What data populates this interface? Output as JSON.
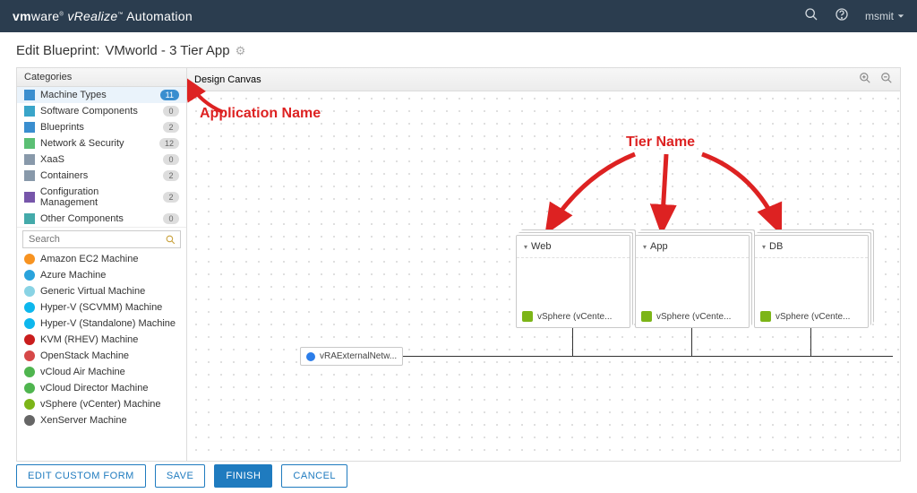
{
  "header": {
    "brand_html": "vmware vRealize Automation",
    "user": "msmit"
  },
  "title": {
    "prefix": "Edit Blueprint:",
    "name": "VMworld - 3 Tier App"
  },
  "sidebar": {
    "header": "Categories",
    "search_placeholder": "Search",
    "categories": [
      {
        "label": "Machine Types",
        "count": "11",
        "selected": true,
        "icon": "#3a8ecf"
      },
      {
        "label": "Software Components",
        "count": "0",
        "icon": "#3aa5c9"
      },
      {
        "label": "Blueprints",
        "count": "2",
        "icon": "#3a8ecf"
      },
      {
        "label": "Network & Security",
        "count": "12",
        "icon": "#5bbf74"
      },
      {
        "label": "XaaS",
        "count": "0",
        "icon": "#8899aa"
      },
      {
        "label": "Containers",
        "count": "2",
        "icon": "#8899aa"
      },
      {
        "label": "Configuration Management",
        "count": "2",
        "icon": "#7756aa"
      },
      {
        "label": "Other Components",
        "count": "0",
        "icon": "#4aa"
      }
    ],
    "machine_types": [
      {
        "label": "Amazon EC2 Machine",
        "color": "#f79321"
      },
      {
        "label": "Azure Machine",
        "color": "#2aa3dc"
      },
      {
        "label": "Generic Virtual Machine",
        "color": "#89d3e4"
      },
      {
        "label": "Hyper-V (SCVMM) Machine",
        "color": "#0db7ed"
      },
      {
        "label": "Hyper-V (Standalone) Machine",
        "color": "#0db7ed"
      },
      {
        "label": "KVM (RHEV) Machine",
        "color": "#c91d1d"
      },
      {
        "label": "OpenStack Machine",
        "color": "#d64848"
      },
      {
        "label": "vCloud Air Machine",
        "color": "#4fb54f"
      },
      {
        "label": "vCloud Director Machine",
        "color": "#4fb54f"
      },
      {
        "label": "vSphere (vCenter) Machine",
        "color": "#7cb518"
      },
      {
        "label": "XenServer Machine",
        "color": "#666666"
      }
    ]
  },
  "canvas": {
    "header": "Design Canvas",
    "tiers": [
      {
        "name": "Web",
        "footer": "vSphere (vCente..."
      },
      {
        "name": "App",
        "footer": "vSphere (vCente..."
      },
      {
        "name": "DB",
        "footer": "vSphere (vCente..."
      }
    ],
    "network_node": "vRAExternalNetw..."
  },
  "annotations": {
    "app_name": "Application Name",
    "tier_name": "Tier Name"
  },
  "footer": {
    "custom": "EDIT CUSTOM FORM",
    "save": "SAVE",
    "finish": "FINISH",
    "cancel": "CANCEL"
  }
}
